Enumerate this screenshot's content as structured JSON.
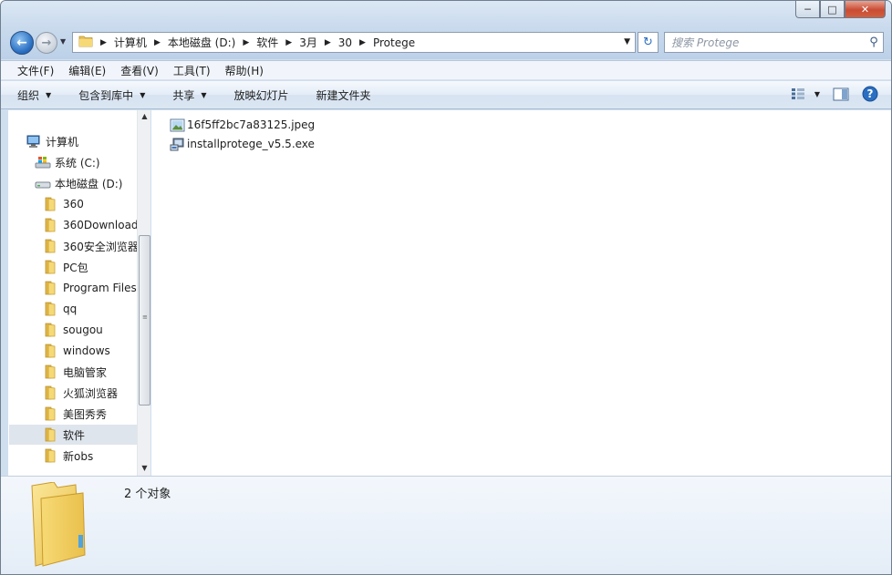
{
  "window": {
    "caption_minimize": "─",
    "caption_maximize": "□",
    "caption_close": "✕"
  },
  "address_bar": {
    "breadcrumbs": [
      "计算机",
      "本地磁盘 (D:)",
      "软件",
      "3月",
      "30",
      "Protege"
    ]
  },
  "search": {
    "placeholder": "搜索 Protege"
  },
  "menu": {
    "items": [
      "文件(F)",
      "编辑(E)",
      "查看(V)",
      "工具(T)",
      "帮助(H)"
    ]
  },
  "toolbar": {
    "organize": "组织",
    "include_in_library": "包含到库中",
    "share": "共享",
    "slideshow": "放映幻灯片",
    "new_folder": "新建文件夹"
  },
  "nav_tree": {
    "computer": "计算机",
    "system_drive": "系统 (C:)",
    "local_drive": "本地磁盘 (D:)",
    "folders": [
      "360",
      "360Download",
      "360安全浏览器",
      "PC包",
      "Program Files",
      "qq",
      "sougou",
      "windows",
      "电脑管家",
      "火狐浏览器",
      "美图秀秀",
      "软件",
      "新obs"
    ],
    "selected": "软件"
  },
  "files": [
    {
      "name": "16f5ff2bc7a83125.jpeg",
      "icon": "image-file-icon"
    },
    {
      "name": "installprotege_v5.5.exe",
      "icon": "installer-file-icon"
    }
  ],
  "details": {
    "count": "2 个对象"
  }
}
